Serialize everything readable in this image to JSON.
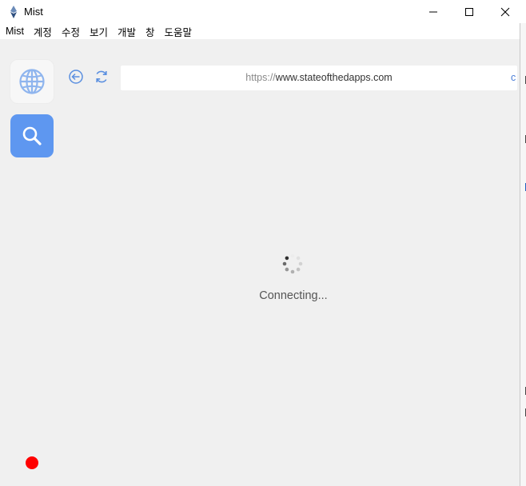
{
  "window": {
    "title": "Mist",
    "controls": [
      "minimize-icon",
      "maximize-icon",
      "close-icon"
    ]
  },
  "menu": {
    "items": [
      "Mist",
      "계정",
      "수정",
      "보기",
      "개발",
      "창",
      "도움말"
    ]
  },
  "sidebar": {
    "items": [
      {
        "icon": "globe-icon",
        "selected": false
      },
      {
        "icon": "search-icon",
        "selected": true
      }
    ]
  },
  "navigation": {
    "back_icon": "back-arrow-icon",
    "reload_icon": "reload-icon",
    "url_protocol": "https://",
    "url_host": "www.stateofthedapps.com",
    "url_overflow": "c"
  },
  "loading": {
    "text": "Connecting..."
  },
  "status": {
    "indicator_color": "#ff0000"
  },
  "colors": {
    "accent": "#5e97f0",
    "link": "#4a7dd8"
  }
}
